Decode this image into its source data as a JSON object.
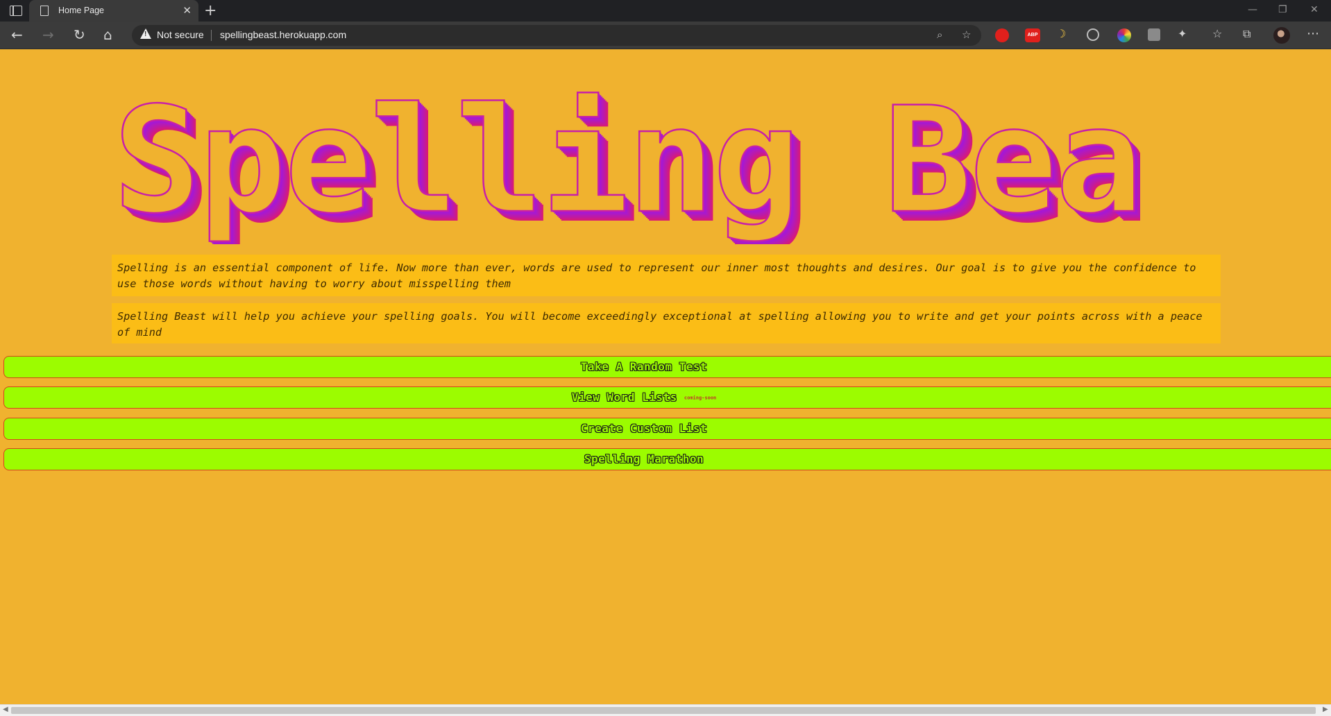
{
  "browser": {
    "tab_title": "Home Page",
    "tab_close": "✕",
    "new_tab": "+",
    "window_controls": {
      "minimize": "—",
      "restore": "❐",
      "close": "✕"
    },
    "nav": {
      "back": "←",
      "forward": "→",
      "reload": "↻",
      "home": "⌂"
    },
    "security_label": "Not secure",
    "url": "spellingbeast.herokuapp.com",
    "extensions": {
      "abp_label": "ABP",
      "moon": "☽",
      "puzzle": "✦",
      "favorites": "☆",
      "collections": "⧉",
      "menu": "⋯"
    },
    "icons": [
      "zoom-icon",
      "favorite-add-icon",
      "extension-red-icon",
      "adblock-icon",
      "dark-mode-icon",
      "extension-circle-icon",
      "color-wheel-icon",
      "extension-a-icon",
      "extensions-icon",
      "favorites-icon",
      "collections-icon",
      "profile-avatar",
      "more-icon"
    ]
  },
  "page": {
    "title": "Spelling Beast",
    "intro_1": "Spelling is an essential component of life. Now more than ever, words are used to represent our inner most thoughts and desires. Our goal is to give you the confidence to use those words without having to worry about misspelling them",
    "intro_2": "Spelling Beast will help you achieve your spelling goals. You will become exceedingly exceptional at spelling allowing you to write and get your points across with a peace of mind",
    "buttons": [
      {
        "label": "Take A Random Test"
      },
      {
        "label": "View Word Lists",
        "tag": "coming-soon"
      },
      {
        "label": "Create Custom List"
      },
      {
        "label": "Spelling Marathon"
      }
    ]
  },
  "colors": {
    "page_bg": "#f0b22f",
    "panel_bg": "#fbbd16",
    "button_bg": "#9cfc00",
    "button_border": "#d2461a",
    "title_gradient": [
      "#a318d8",
      "#d61a78"
    ]
  }
}
